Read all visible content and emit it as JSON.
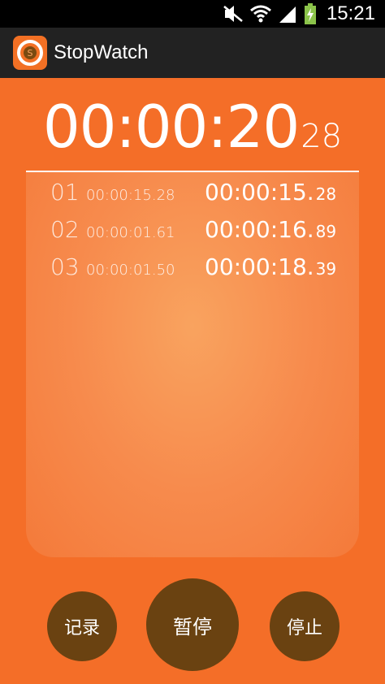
{
  "status_bar": {
    "time": "15:21"
  },
  "action_bar": {
    "title": "StopWatch",
    "icon_letter": "S"
  },
  "timer": {
    "main": "00:00:20",
    "ms": "28"
  },
  "laps": [
    {
      "no": "01",
      "split": "00:00:15.28",
      "total": "00:00:15.",
      "total_ms": "28"
    },
    {
      "no": "02",
      "split": "00:00:01.61",
      "total": "00:00:16.",
      "total_ms": "89"
    },
    {
      "no": "03",
      "split": "00:00:01.50",
      "total": "00:00:18.",
      "total_ms": "39"
    }
  ],
  "buttons": {
    "lap": "记录",
    "pause": "暂停",
    "stop": "停止"
  },
  "colors": {
    "background": "#f46e28",
    "button": "#6a4211",
    "action_bar": "#222222"
  },
  "icons": [
    "silent-icon",
    "wifi-icon",
    "signal-icon",
    "battery-charging-icon",
    "stopwatch-app-icon"
  ]
}
